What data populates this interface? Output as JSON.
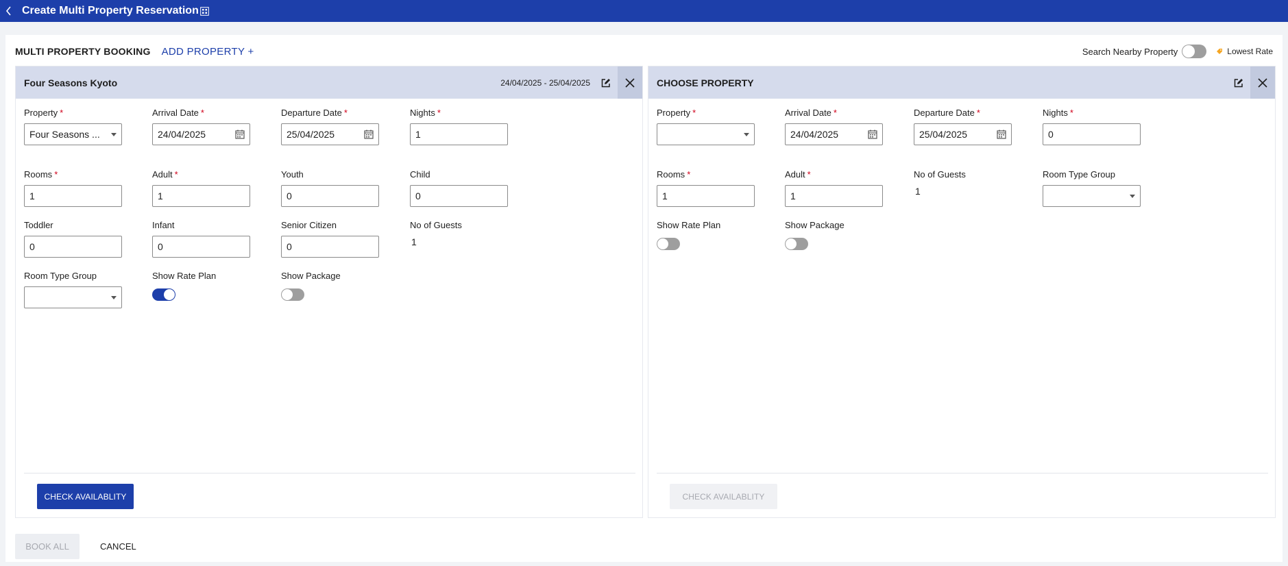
{
  "topbar": {
    "title": "Create Multi Property Reservation"
  },
  "header": {
    "mpb_label": "MULTI PROPERTY BOOKING",
    "add_property_label": "ADD PROPERTY +",
    "search_nearby_label": "Search Nearby Property",
    "search_nearby_on": false,
    "lowest_rate_label": "Lowest Rate"
  },
  "colors": {
    "brand": "#1d3faa",
    "card_header": "#d5dbec",
    "required": "#d0021b",
    "lowest_rate_tag": "#f5a623"
  },
  "card1": {
    "title": "Four Seasons Kyoto",
    "dates": "24/04/2025 - 25/04/2025",
    "property": {
      "label": "Property",
      "value": "Four Seasons ..."
    },
    "arrival": {
      "label": "Arrival Date",
      "value": "24/04/2025"
    },
    "departure": {
      "label": "Departure Date",
      "value": "25/04/2025"
    },
    "nights": {
      "label": "Nights",
      "value": "1"
    },
    "rooms": {
      "label": "Rooms",
      "value": "1"
    },
    "adult": {
      "label": "Adult",
      "value": "1"
    },
    "youth": {
      "label": "Youth",
      "value": "0"
    },
    "child": {
      "label": "Child",
      "value": "0"
    },
    "toddler": {
      "label": "Toddler",
      "value": "0"
    },
    "infant": {
      "label": "Infant",
      "value": "0"
    },
    "senior": {
      "label": "Senior Citizen",
      "value": "0"
    },
    "guests": {
      "label": "No of Guests",
      "value": "1"
    },
    "room_type_group": {
      "label": "Room Type Group",
      "value": ""
    },
    "show_rate_plan": {
      "label": "Show Rate Plan",
      "on": true
    },
    "show_package": {
      "label": "Show Package",
      "on": false
    },
    "check_label": "CHECK AVAILABLITY"
  },
  "card2": {
    "title": "CHOOSE PROPERTY",
    "property": {
      "label": "Property",
      "value": ""
    },
    "arrival": {
      "label": "Arrival Date",
      "value": "24/04/2025"
    },
    "departure": {
      "label": "Departure Date",
      "value": "25/04/2025"
    },
    "nights": {
      "label": "Nights",
      "value": "0"
    },
    "rooms": {
      "label": "Rooms",
      "value": "1"
    },
    "adult": {
      "label": "Adult",
      "value": "1"
    },
    "guests": {
      "label": "No of Guests",
      "value": "1"
    },
    "room_type_group": {
      "label": "Room Type Group",
      "value": ""
    },
    "show_rate_plan": {
      "label": "Show Rate Plan",
      "on": false
    },
    "show_package": {
      "label": "Show Package",
      "on": false
    },
    "check_label": "CHECK AVAILABLITY"
  },
  "footer": {
    "book_all_label": "BOOK ALL",
    "cancel_label": "CANCEL"
  }
}
